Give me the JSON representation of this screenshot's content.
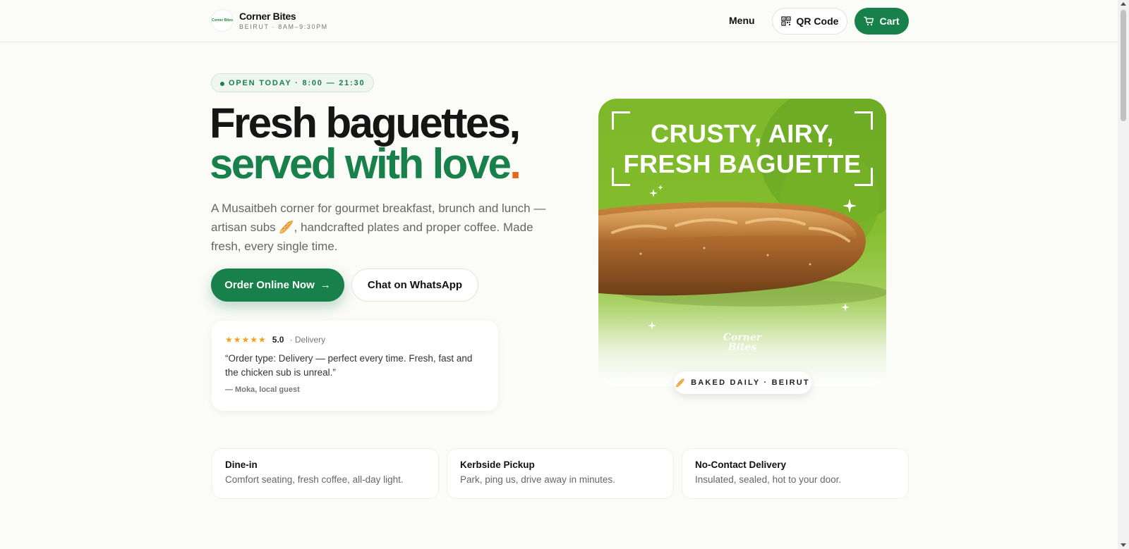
{
  "header": {
    "logo_text": "Corner Bites",
    "brand_name": "Corner Bites",
    "brand_sub": "BEIRUT · 8AM–9:30PM",
    "nav_menu": "Menu",
    "qr_label": "QR Code",
    "cart_label": "Cart"
  },
  "hero": {
    "open_badge": "OPEN TODAY · 8:00 — 21:30",
    "title_line1": "Fresh baguettes,",
    "title_line2": "served with love",
    "title_dot": ".",
    "description": "A Musaitbeh corner for gourmet breakfast, brunch and lunch — artisan subs 🥖, handcrafted plates and proper coffee. Made fresh, every single time.",
    "order_button": "Order Online Now",
    "order_arrow": "→",
    "whatsapp_button": "Chat on WhatsApp"
  },
  "review": {
    "stars": "★★★★★",
    "rating": "5.0",
    "type": "· Delivery",
    "quote": "“Order type: Delivery — perfect every time. Fresh, fast and the chicken sub is unreal.”",
    "author": "— Moka, local guest"
  },
  "promo": {
    "headline_line1": "CRUSTY, AIRY,",
    "headline_line2": "FRESH BAGUETTE",
    "watermark_line1": "Corner",
    "watermark_line2": "Bites",
    "baked_icon": "🥖",
    "baked_label": "BAKED DAILY · BEIRUT"
  },
  "services": [
    {
      "title": "Dine-in",
      "desc": "Comfort seating, fresh coffee, all-day light."
    },
    {
      "title": "Kerbside Pickup",
      "desc": "Park, ping us, drive away in minutes."
    },
    {
      "title": "No-Contact Delivery",
      "desc": "Insulated, sealed, hot to your door."
    }
  ],
  "colors": {
    "brand_green": "#18804a",
    "accent_orange": "#e8651e",
    "star_gold": "#f4a21b",
    "promo_green": "#7cb82a"
  },
  "icons": {
    "qr": "qr-code-icon",
    "cart": "cart-icon",
    "open": "status-dot-icon",
    "sparkle": "sparkle-icon"
  }
}
